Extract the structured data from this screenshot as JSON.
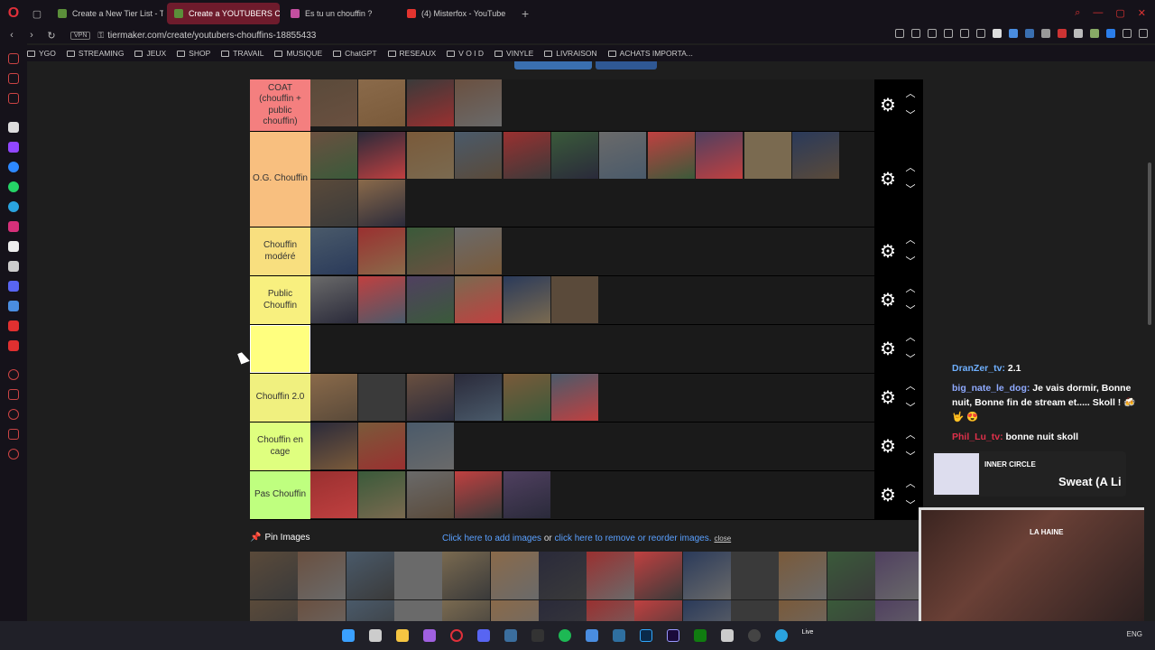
{
  "browser": {
    "tabs": [
      {
        "label": "Create a New Tier List - T",
        "color": "#5b8f3a",
        "active": false
      },
      {
        "label": "Create a YOUTUBERS CH",
        "color": "#5b8f3a",
        "active": true
      },
      {
        "label": "Es tu un chouffin ?",
        "color": "#c34fa0",
        "active": false
      },
      {
        "label": "(4) Misterfox - YouTube",
        "color": "#e3342f",
        "active": false
      }
    ],
    "new_tab_symbol": "+",
    "url": "tiermaker.com/create/youtubers-chouffins-18855433",
    "vpn_label": "VPN"
  },
  "bookmarks": [
    {
      "label": "YGO"
    },
    {
      "label": "STREAMING"
    },
    {
      "label": "JEUX"
    },
    {
      "label": "SHOP"
    },
    {
      "label": "TRAVAIL"
    },
    {
      "label": "MUSIQUE"
    },
    {
      "label": "ChatGPT"
    },
    {
      "label": "RESEAUX"
    },
    {
      "label": "V O I D"
    },
    {
      "label": "VINYLE"
    },
    {
      "label": "LIVRAISON"
    },
    {
      "label": "ACHATS IMPORTA..."
    }
  ],
  "tiers": [
    {
      "label": "COAT (chouffin + public chouffin)",
      "color": "#f47f7f",
      "count": 4
    },
    {
      "label": "O.G. Chouffin",
      "color": "#f8bf7f",
      "count": 13
    },
    {
      "label": "Chouffin modéré",
      "color": "#f8df7f",
      "count": 4
    },
    {
      "label": "Public Chouffin",
      "color": "#f8f07f",
      "count": 6
    },
    {
      "label": "",
      "color": "#ffff7f",
      "count": 0
    },
    {
      "label": "Chouffin 2.0",
      "color": "#f0f07f",
      "count": 6
    },
    {
      "label": "Chouffin en cage",
      "color": "#dfff7f",
      "count": 3
    },
    {
      "label": "Pas Chouffin",
      "color": "#bfff7f",
      "count": 5
    }
  ],
  "pin_images_label": "Pin Images",
  "add_images": {
    "link1": "Click here to add images",
    "or": " or ",
    "link2": "click here to remove or reorder images.",
    "close": "close"
  },
  "chat": {
    "messages": [
      {
        "user": "DranZer_tv:",
        "text": " 2.1"
      },
      {
        "user": "big_nate_le_dog:",
        "text": " Je vais dormir, Bonne nuit, Bonne fin de stream et..... Skoll ! 🍻 🤟 😍"
      },
      {
        "user": "Phil_Lu_tv:",
        "text": " bonne nuit skoll"
      }
    ],
    "banner_title": "INNER CIRCLE",
    "banner_text": "Sweat (A Li"
  },
  "webcam_sign": "LA HAINE",
  "taskbar": {
    "lang": "ENG",
    "live": "Live"
  },
  "icons": {
    "gear": "⚙",
    "up": "︿",
    "down": "﹀",
    "back": "‹",
    "forward": "›",
    "reload": "↻",
    "lock": "🔒",
    "pin": "📌"
  }
}
